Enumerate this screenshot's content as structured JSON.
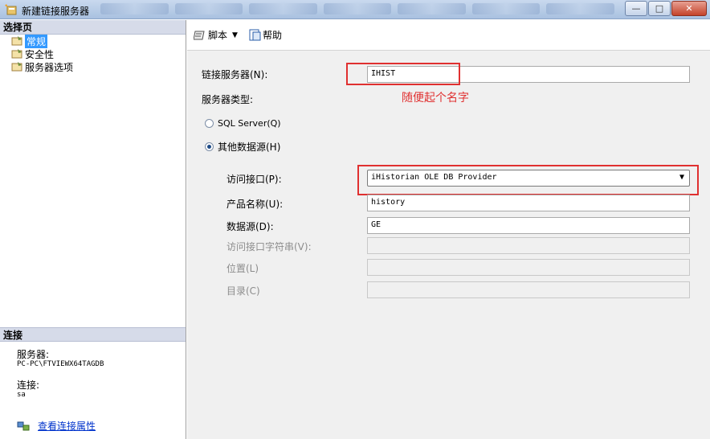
{
  "window": {
    "title": "新建链接服务器",
    "minimize": "—",
    "maximize": "□",
    "close": "✕"
  },
  "left_panel": {
    "header": "选择页",
    "pages": [
      {
        "label": "常规",
        "selected": true
      },
      {
        "label": "安全性",
        "selected": false
      },
      {
        "label": "服务器选项",
        "selected": false
      }
    ],
    "connection": {
      "header": "连接",
      "server_label": "服务器:",
      "server_value": "PC-PC\\FTVIEWX64TAGDB",
      "connection_label": "连接:",
      "connection_value": "sa",
      "link_text": "查看连接属性"
    }
  },
  "toolbar": {
    "script_label": "脚本",
    "help_label": "帮助"
  },
  "form": {
    "linked_server_label": "链接服务器(N):",
    "linked_server_value": "IHIST",
    "server_type_label": "服务器类型:",
    "annotation": "随便起个名字",
    "sql_server_label": "SQL Server(Q)",
    "other_source_label": "其他数据源(H)",
    "provider_label": "访问接口(P):",
    "provider_value": "iHistorian OLE DB Provider",
    "product_label": "产品名称(U):",
    "product_value": "history",
    "datasource_label": "数据源(D):",
    "datasource_value": "GE",
    "provider_string_label": "访问接口字符串(V):",
    "location_label": "位置(L)",
    "catalog_label": "目录(C)"
  },
  "colors": {
    "annotation_red": "#e03030",
    "selected_blue": "#3399ff",
    "link_blue": "#0033cc"
  }
}
